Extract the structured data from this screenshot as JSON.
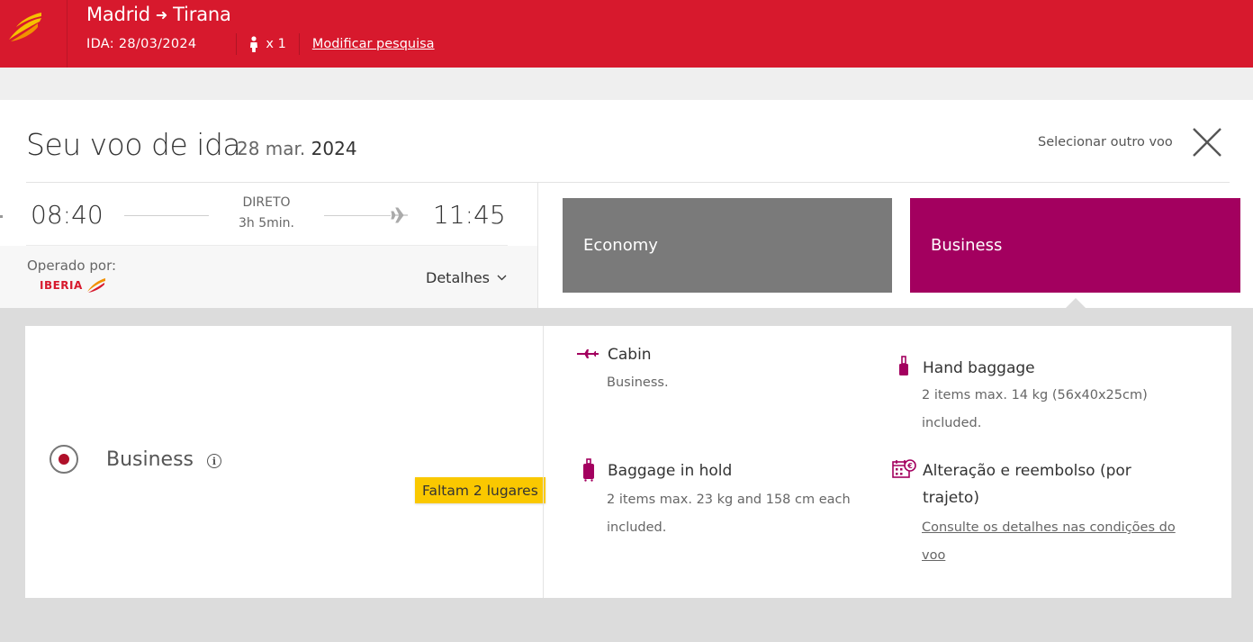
{
  "header": {
    "origin": "Madrid",
    "route_arrow": "➜",
    "destination": "Tirana",
    "date_label": "IDA: 28/03/2024",
    "passengers": "x 1",
    "modify_link": "Modificar pesquisa",
    "brand_color": "#d7192d"
  },
  "flight": {
    "title": "Seu voo de ida",
    "date_day_month": "28 mar.",
    "date_year": "2024",
    "select_other": "Selecionar outro voo",
    "departure_time": "08:40",
    "arrival_time": "11:45",
    "stops": "DIRETO",
    "duration": "3h 5min.",
    "operated_by_label": "Operado por:",
    "operator_logo_text": "IBERIA",
    "details_label": "Detalhes"
  },
  "fare_tabs": [
    {
      "label": "Economy",
      "color": "#7a7a7a",
      "selected": false
    },
    {
      "label": "Business",
      "color": "#a3005f",
      "selected": true
    }
  ],
  "fare": {
    "class_name": "Business",
    "seats_left": "Faltam 2 lugares",
    "features": {
      "cabin": {
        "icon": "plane-cabin-icon",
        "title": "Cabin",
        "desc": "Business."
      },
      "hand_baggage": {
        "icon": "hand-baggage-icon",
        "title": "Hand baggage",
        "desc_line1": "2 items max. 14 kg (56x40x25cm)",
        "desc_line2": "included."
      },
      "hold_baggage": {
        "icon": "suitcase-icon",
        "title": "Baggage in hold",
        "desc_line1": "2 items max. 23 kg and 158 cm each",
        "desc_line2": "included."
      },
      "change_refund": {
        "icon": "calendar-euro-icon",
        "title_line1": "Alteração e reembolso (por",
        "title_line2": "trajeto)",
        "link_line1": "Consulte os detalhes nas condições do",
        "link_line2": "voo"
      }
    },
    "accent_color": "#a3005f"
  }
}
